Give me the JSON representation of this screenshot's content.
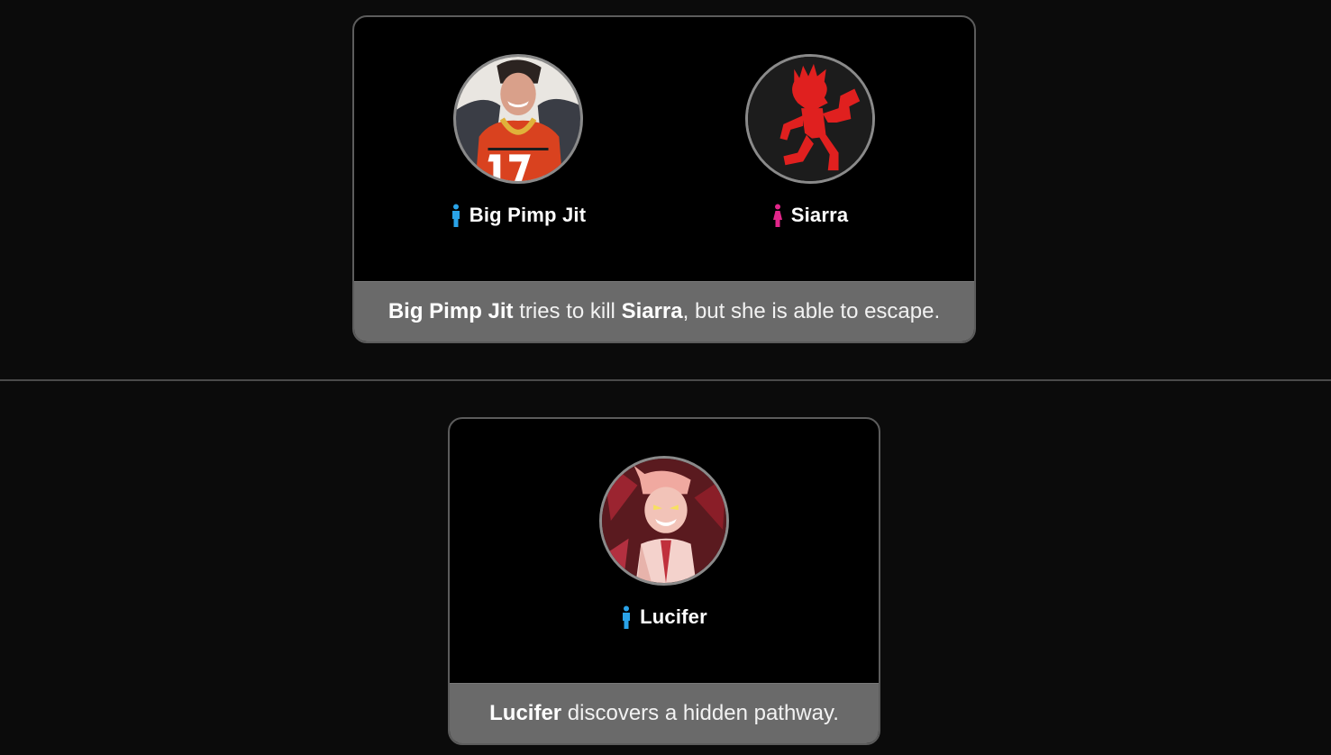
{
  "events": [
    {
      "players": [
        {
          "name": "Big Pimp Jit",
          "gender": "male",
          "avatar": "football-player-avatar"
        },
        {
          "name": "Siarra",
          "gender": "female",
          "avatar": "hatchetman-avatar"
        }
      ],
      "caption": {
        "actor": "Big Pimp Jit",
        "text1": " tries to kill ",
        "target": "Siarra",
        "text2": ", but she is able to escape."
      }
    },
    {
      "players": [
        {
          "name": "Lucifer",
          "gender": "male",
          "avatar": "demon-character-avatar"
        }
      ],
      "caption": {
        "actor": "Lucifer",
        "text1": " discovers a hidden pathway."
      }
    }
  ],
  "colors": {
    "male_icon": "#2aa3e8",
    "female_icon": "#e2268a",
    "caption_bg": "#6a6a6a",
    "card_border": "#5c5c5c"
  }
}
